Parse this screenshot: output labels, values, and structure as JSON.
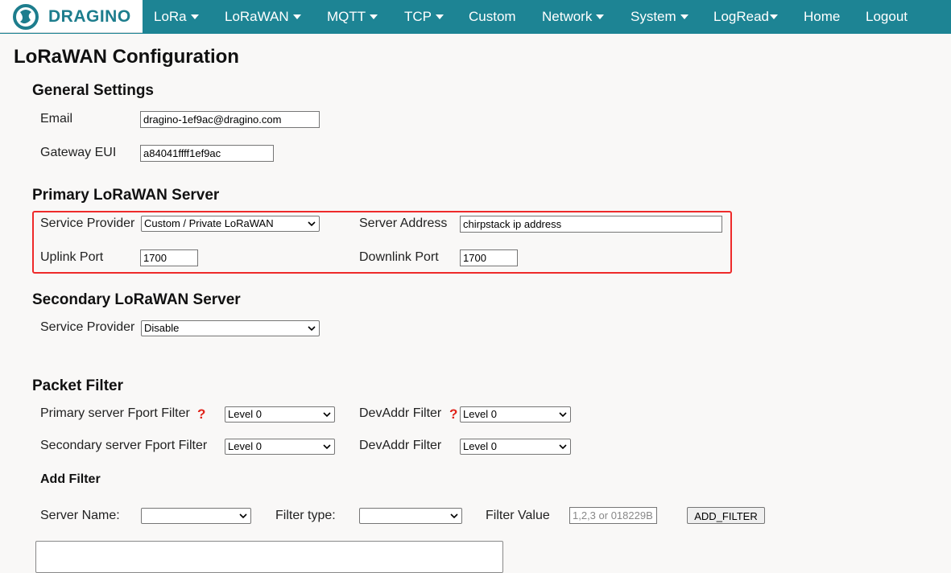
{
  "nav": {
    "logo_text": "DRAGINO",
    "items": [
      "LoRa",
      "LoRaWAN",
      "MQTT",
      "TCP",
      "Custom",
      "Network",
      "System",
      "LogRead",
      "Home",
      "Logout"
    ]
  },
  "page": {
    "title": "LoRaWAN Configuration"
  },
  "general": {
    "heading": "General Settings",
    "email_label": "Email",
    "email_value": "dragino-1ef9ac@dragino.com",
    "eui_label": "Gateway EUI",
    "eui_value": "a84041ffff1ef9ac"
  },
  "primary": {
    "heading": "Primary LoRaWAN Server",
    "provider_label": "Service Provider",
    "provider_value": "Custom / Private LoRaWAN",
    "address_label": "Server Address",
    "address_value": "chirpstack ip address",
    "uplink_label": "Uplink Port",
    "uplink_value": "1700",
    "downlink_label": "Downlink Port",
    "downlink_value": "1700"
  },
  "secondary": {
    "heading": "Secondary LoRaWAN Server",
    "provider_label": "Service Provider",
    "provider_value": "Disable"
  },
  "filter": {
    "heading": "Packet Filter",
    "primary_fport_label": "Primary server Fport Filter",
    "primary_fport_value": "Level 0",
    "primary_devaddr_label": "DevAddr Filter",
    "primary_devaddr_value": "Level 0",
    "secondary_fport_label": "Secondary server Fport Filter",
    "secondary_fport_value": "Level 0",
    "secondary_devaddr_label": "DevAddr Filter",
    "secondary_devaddr_value": "Level 0",
    "help_mark": "?"
  },
  "add_filter": {
    "heading": "Add Filter",
    "server_name_label": "Server Name:",
    "server_name_value": "",
    "filter_type_label": "Filter type:",
    "filter_type_value": "",
    "filter_value_label": "Filter Value",
    "filter_value_placeholder": "1,2,3 or 018229B",
    "button_label": "ADD_FILTER"
  },
  "colors": {
    "nav_bg": "#1d8494",
    "highlight_border": "#ee2a2a",
    "help_mark": "#e0241b"
  }
}
